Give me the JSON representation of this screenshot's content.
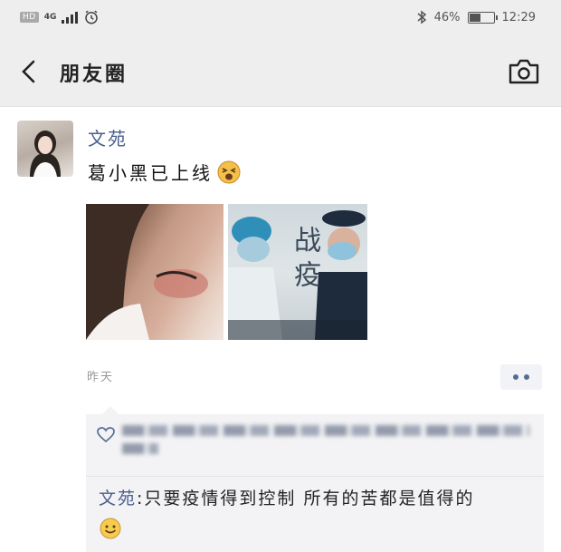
{
  "status_bar": {
    "hd_label": "HD",
    "network_label": "4G",
    "network_sub": "46",
    "battery_percent": "46%",
    "battery_level": 0.46,
    "time": "12:29"
  },
  "nav": {
    "title": "朋友圈",
    "back_icon": "chevron-left-icon",
    "camera_icon": "camera-icon"
  },
  "post": {
    "author": "文苑",
    "text": "葛小黑已上线",
    "emoji": "tired-face-emoji",
    "photo_2_text": "战疫",
    "timestamp": "昨天"
  },
  "comments": {
    "heart_icon": "heart-outline-icon",
    "items": [
      {
        "author": "文苑",
        "separator": ":",
        "text": "只要疫情得到控制 所有的苦都是值得的",
        "emoji": "smile-emoji"
      }
    ]
  },
  "colors": {
    "link": "#4a5f8d",
    "bar_background": "#eeeeee",
    "comment_background": "#f3f3f5"
  }
}
